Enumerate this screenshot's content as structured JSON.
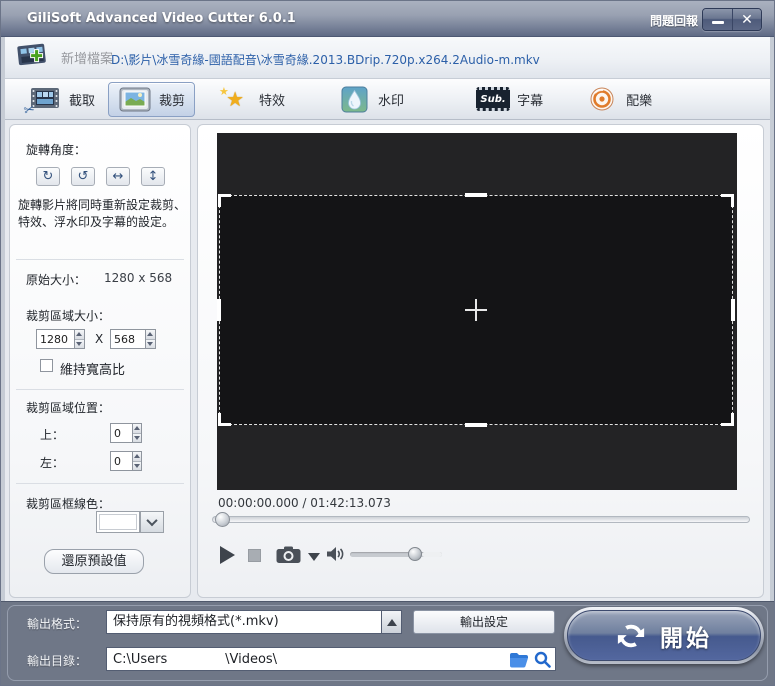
{
  "window": {
    "title": "GiliSoft Advanced Video Cutter 6.0.1",
    "feedback_label": "問題回報",
    "close_glyph": "✕"
  },
  "toolbar": {
    "add_file_label": "新增檔案",
    "file_path": "D:\\影片\\冰雪奇緣-國語配音\\冰雪奇緣.2013.BDrip.720p.x264.2Audio-m.mkv"
  },
  "tabs": [
    {
      "label": "截取",
      "selected": false
    },
    {
      "label": "裁剪",
      "selected": true
    },
    {
      "label": "特效",
      "selected": false
    },
    {
      "label": "水印",
      "selected": false
    },
    {
      "label": "字幕",
      "selected": false,
      "icon_text": "Sub."
    },
    {
      "label": "配樂",
      "selected": false
    }
  ],
  "icons": {
    "rotate_cw": "↻",
    "rotate_ccw": "↺",
    "flip_h": "↔",
    "flip_v": "↕",
    "scissors": "✂",
    "star": "★"
  },
  "sidebar": {
    "rotate_label": "旋轉角度：",
    "rotate_note": "旋轉影片將同時重新設定裁剪、特效、浮水印及字幕的設定。",
    "original_size_label": "原始大小：",
    "original_size_value": "1280 x 568",
    "crop_size_label": "裁剪區域大小：",
    "crop_width": "1280",
    "crop_height": "568",
    "times_label": "X",
    "keep_aspect_label": "維持寬高比",
    "keep_aspect_checked": false,
    "position_label": "裁剪區域位置：",
    "top_label": "上：",
    "top_value": "0",
    "left_label": "左：",
    "left_value": "0",
    "border_color_label": "裁剪區框線色：",
    "border_color_value": "#ffffff",
    "reset_button_label": "還原預設值"
  },
  "player": {
    "time_display": "00:00:00.000 / 01:42:13.073",
    "volume_percent": 70,
    "seek_percent": 0
  },
  "output": {
    "format_label": "輸出格式：",
    "format_value": "保持原有的視頻格式(*.mkv)",
    "settings_button_label": "輸出設定",
    "dir_label": "輸出目錄：",
    "dir_value": "C:\\Users              \\Videos\\",
    "start_label": "開始"
  },
  "colors": {
    "titlebar_top": "#aab1c0",
    "titlebar_bottom": "#5f6a85",
    "bottom_bar": "#6f7787",
    "path_text": "#2b5fa8",
    "start_blue": "#465a8e",
    "video_bg": "#232325",
    "crop_bg": "#141416"
  }
}
